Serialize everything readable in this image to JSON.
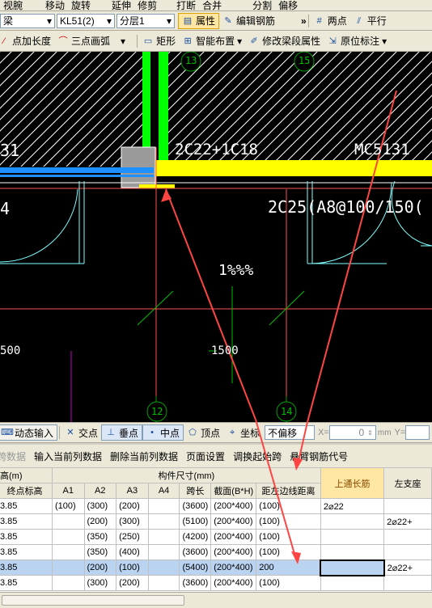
{
  "toolbar1": {
    "items": [
      "视腕",
      "移动",
      "旋转",
      "延伸",
      "修剪",
      "打断",
      "合并",
      "分割",
      "偏移"
    ]
  },
  "toolbar2": {
    "type_value": "梁",
    "member_value": "KL51(2)",
    "layer_value": "分层1",
    "properties_label": "属性",
    "edit_rebar_label": "编辑钢筋",
    "more": "»",
    "two_point_label": "两点",
    "parallel_label": "平行"
  },
  "toolbar3": {
    "point_length_label": "点加长度",
    "three_point_arc_label": "三点画弧",
    "rect_label": "矩形",
    "smart_layout_label": "智能布置",
    "edit_beam_props_label": "修改梁段属性",
    "in_situ_label": "原位标注"
  },
  "canvas": {
    "axis_13": "13",
    "axis_15": "15",
    "axis_12": "12",
    "axis_14": "14",
    "label_31": "31",
    "label_top_rebar": "2C22+1C18",
    "label_mc": "MC5131",
    "label_4": "4",
    "label_rebar2": "2C25(A8@100/150(",
    "label_slope": "1%%%",
    "label_500a": "500",
    "label_500b": "1500",
    "colors": {
      "beam": "#ffff00",
      "column": "#00ff00",
      "arrow": "#ff4444",
      "wall": "#ffffff",
      "door": "#80ffff"
    }
  },
  "snap": {
    "dynamic_input": "动态输入",
    "intersection": "交点",
    "perpendicular": "垂点",
    "midpoint": "中点",
    "vertex": "顶点",
    "coordinate": "坐标",
    "offset_value": "不偏移",
    "x_label": "X=",
    "x_value": "0",
    "unit": "mm",
    "y_label": "Y="
  },
  "grid_toolbar": {
    "items": [
      "跨数据",
      "输入当前列数据",
      "删除当前列数据",
      "页面设置",
      "调换起始跨",
      "悬臂钢筋代号"
    ]
  },
  "table": {
    "group_left": "高(m)",
    "group_size": "构件尺寸(mm)",
    "top_rebar_header": "上通长筋",
    "left_support_header": "左支座",
    "columns": [
      "终点标高",
      "A1",
      "A2",
      "A3",
      "A4",
      "跨长",
      "截面(B*H)",
      "距左边线距离"
    ],
    "rows": [
      {
        "lead": "3.85",
        "a1": "(100)",
        "a2": "(300)",
        "a3": "(200)",
        "a4": "",
        "span": "(3600)",
        "section": "(200*400)",
        "dist": "(100)",
        "top": "2⌀22",
        "left": ""
      },
      {
        "lead": "3.85",
        "a1": "",
        "a2": "(200)",
        "a3": "(300)",
        "a4": "",
        "span": "(5100)",
        "section": "(200*400)",
        "dist": "(100)",
        "top": "",
        "left": "2⌀22+"
      },
      {
        "lead": "3.85",
        "a1": "",
        "a2": "(350)",
        "a3": "(250)",
        "a4": "",
        "span": "(4200)",
        "section": "(200*400)",
        "dist": "(100)",
        "top": "",
        "left": ""
      },
      {
        "lead": "3.85",
        "a1": "",
        "a2": "(350)",
        "a3": "(400)",
        "a4": "",
        "span": "(3600)",
        "section": "(200*400)",
        "dist": "(100)",
        "top": "",
        "left": ""
      },
      {
        "lead": "3.85",
        "a1": "",
        "a2": "(200)",
        "a3": "(100)",
        "a4": "",
        "span": "(5400)",
        "section": "(200*400)",
        "dist": "200",
        "top": "",
        "left": "2⌀22+"
      },
      {
        "lead": "3.85",
        "a1": "",
        "a2": "(300)",
        "a3": "(200)",
        "a4": "",
        "span": "(3600)",
        "section": "(200*400)",
        "dist": "(100)",
        "top": "",
        "left": ""
      }
    ]
  }
}
